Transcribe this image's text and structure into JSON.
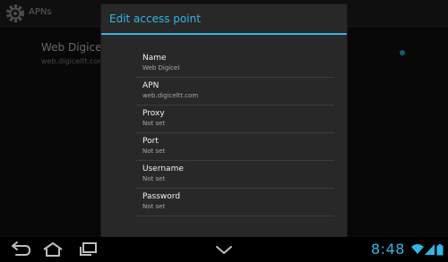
{
  "actionbar": {
    "title": "APNs"
  },
  "apn_list": [
    {
      "name": "Web Digicel",
      "url": "web.digiceltt.com"
    }
  ],
  "dialog": {
    "title": "Edit access point",
    "fields": [
      {
        "label": "Name",
        "value": "Web Digicel"
      },
      {
        "label": "APN",
        "value": "web.digiceltt.com"
      },
      {
        "label": "Proxy",
        "value": "Not set"
      },
      {
        "label": "Port",
        "value": "Not set"
      },
      {
        "label": "Username",
        "value": "Not set"
      },
      {
        "label": "Password",
        "value": "Not set"
      }
    ]
  },
  "statusbar": {
    "time": "8:48"
  },
  "colors": {
    "accent": "#33b5e5",
    "dialog_bg": "#282828",
    "navbar_bg": "#000000"
  },
  "icons": {
    "settings": "gear-icon",
    "back": "back-icon",
    "home": "home-icon",
    "recents": "recent-apps-icon",
    "ime": "chevron-down-icon",
    "wifi": "wifi-icon",
    "signal": "signal-icon",
    "battery": "battery-icon"
  }
}
